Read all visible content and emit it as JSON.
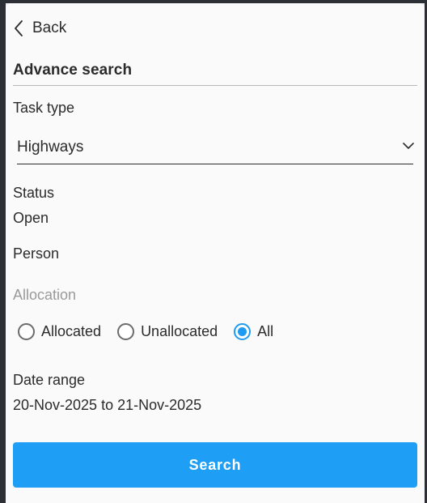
{
  "header": {
    "back_label": "Back",
    "title": "Advance search"
  },
  "task_type": {
    "label": "Task type",
    "selected": "Highways"
  },
  "status": {
    "label": "Status",
    "value": "Open"
  },
  "person": {
    "label": "Person"
  },
  "allocation": {
    "label": "Allocation",
    "options": [
      {
        "label": "Allocated",
        "selected": false
      },
      {
        "label": "Unallocated",
        "selected": false
      },
      {
        "label": "All",
        "selected": true
      }
    ]
  },
  "date_range": {
    "label": "Date range",
    "value": "20-Nov-2025 to 21-Nov-2025"
  },
  "actions": {
    "search_label": "Search"
  },
  "colors": {
    "accent": "#1f9ef5",
    "text": "#2b2b2b",
    "muted": "#9a9a9a"
  },
  "icons": {
    "back": "chevron-left-icon",
    "dropdown": "chevron-down-icon"
  }
}
